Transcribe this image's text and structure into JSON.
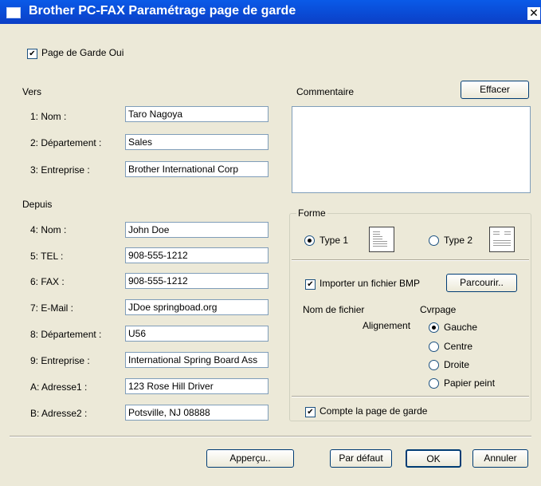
{
  "window": {
    "title": "Brother PC-FAX Paramétrage page de garde",
    "close_glyph": "✕"
  },
  "cover": {
    "checkbox_label": "Page de Garde Oui",
    "checked": true
  },
  "to": {
    "section_label": "Vers",
    "fields": [
      {
        "label": "1: Nom :",
        "value": "Taro Nagoya"
      },
      {
        "label": "2: Département :",
        "value": "Sales"
      },
      {
        "label": "3: Entreprise :",
        "value": "Brother International Corp"
      }
    ]
  },
  "from": {
    "section_label": "Depuis",
    "fields": [
      {
        "label": "4: Nom :",
        "value": "John Doe"
      },
      {
        "label": "5: TEL :",
        "value": "908-555-1212"
      },
      {
        "label": "6: FAX :",
        "value": "908-555-1212"
      },
      {
        "label": "7: E-Mail :",
        "value": "JDoe springboad.org"
      },
      {
        "label": "8: Département :",
        "value": "U56"
      },
      {
        "label": "9: Entreprise :",
        "value": "International Spring Board Ass"
      },
      {
        "label": "A: Adresse1 :",
        "value": "123 Rose Hill Driver"
      },
      {
        "label": "B: Adresse2 :",
        "value": "Potsville, NJ 08888"
      }
    ]
  },
  "comment": {
    "label": "Commentaire",
    "clear_button": "Effacer",
    "text": ""
  },
  "forme": {
    "label": "Forme",
    "type1_label": "Type 1",
    "type2_label": "Type 2",
    "selected": "Type 1",
    "bmp_checkbox_label": "Importer un fichier BMP",
    "bmp_checked": true,
    "browse_button": "Parcourir..",
    "filename_label": "Nom de fichier",
    "filename_value": "Cvrpage",
    "alignment_label": "Alignement",
    "alignment_options": [
      "Gauche",
      "Centre",
      "Droite",
      "Papier peint"
    ],
    "alignment_selected": "Gauche",
    "count_checkbox_label": "Compte la page de garde",
    "count_checked": true
  },
  "footer": {
    "preview_button": "Apperçu..",
    "default_button": "Par défaut",
    "ok_button": "OK",
    "cancel_button": "Annuler"
  },
  "icons": {
    "checkmark": "✔"
  }
}
